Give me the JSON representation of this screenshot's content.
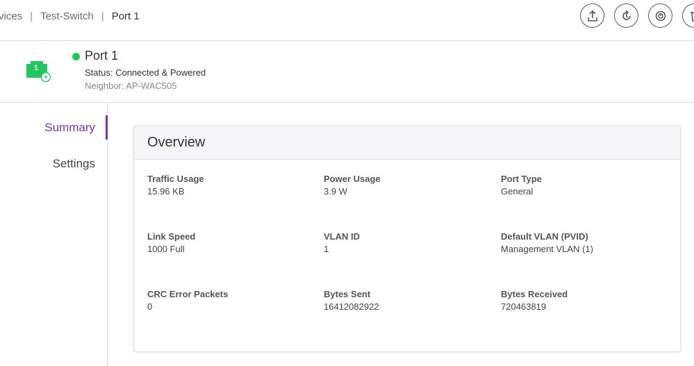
{
  "breadcrumb": {
    "items": [
      "vices",
      "Test-Switch",
      "Port 1"
    ]
  },
  "toolbar": {
    "buttons": [
      "upload-icon",
      "refresh-icon",
      "power-cycle-icon",
      "delete-icon"
    ]
  },
  "device": {
    "port_badge": "1",
    "name": "Port 1",
    "status": "Status: Connected & Powered",
    "neighbor": "Neighbor: AP-WAC505",
    "status_color": "#22c55e",
    "icon_color": "#22c55e"
  },
  "nav": {
    "summary": "Summary",
    "settings": "Settings",
    "accent": "#7b2fb5"
  },
  "overview": {
    "title": "Overview",
    "metrics": [
      {
        "label": "Traffic Usage",
        "value": "15.96 KB"
      },
      {
        "label": "Power Usage",
        "value": "3.9 W"
      },
      {
        "label": "Port Type",
        "value": "General"
      },
      {
        "label": "Link Speed",
        "value": "1000 Full"
      },
      {
        "label": "VLAN ID",
        "value": "1"
      },
      {
        "label": "Default VLAN (PVID)",
        "value": "Management VLAN (1)"
      },
      {
        "label": "CRC Error Packets",
        "value": "0"
      },
      {
        "label": "Bytes Sent",
        "value": "16412082922"
      },
      {
        "label": "Bytes Received",
        "value": "720463819"
      }
    ]
  }
}
